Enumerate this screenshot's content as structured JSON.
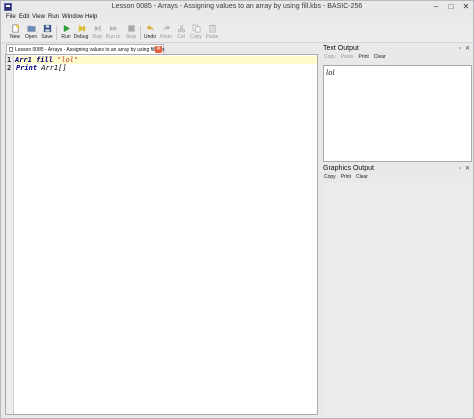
{
  "window": {
    "title": "Lesson 0085 - Arrays - Assigning values to an array by using fill.kbs - BASIC-256",
    "controls": {
      "minimize": "–",
      "maximize": "□",
      "close": "✕"
    }
  },
  "menu": [
    "File",
    "Edit",
    "View",
    "Run",
    "Window",
    "Help"
  ],
  "toolbar": {
    "new": "New",
    "open": "Open",
    "save": "Save",
    "run": "Run",
    "debug": "Debug",
    "step": "Step",
    "run_to": "Run to",
    "stop": "Stop",
    "undo": "Undo",
    "redo": "Redo",
    "cut": "Cut",
    "copy": "Copy",
    "paste": "Paste"
  },
  "editor": {
    "tab_label": "Lesson 0085 - Arrays - Assigning values to an array by using fill.kbs",
    "lines": [
      {
        "num": "1",
        "kw1": "Arr1",
        "kw2": " fill ",
        "str": "\"lol\""
      },
      {
        "num": "2",
        "kw1": "Print",
        "rest": " Arr1[]"
      }
    ]
  },
  "text_output": {
    "title": "Text Output",
    "buttons": [
      "Copy",
      "Paste",
      "Print",
      "Clear"
    ],
    "content": "lol"
  },
  "graphics_output": {
    "title": "Graphics Output",
    "buttons": [
      "Copy",
      "Print",
      "Clear"
    ]
  },
  "pane_controls": {
    "float": "▫",
    "close": "✕"
  },
  "colors": {
    "current_line": "#fffbcc",
    "keyword": "#000080",
    "string": "#c0392b",
    "tab_close": "#e8603c"
  }
}
